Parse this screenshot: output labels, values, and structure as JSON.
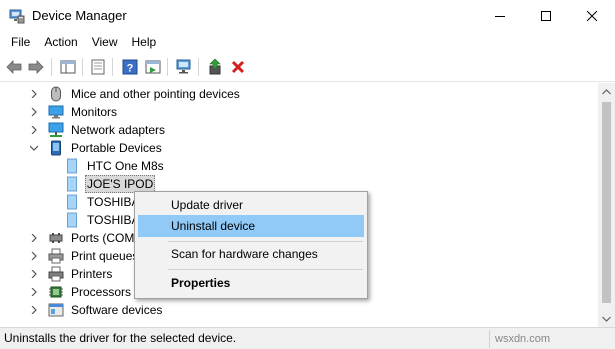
{
  "window": {
    "title": "Device Manager"
  },
  "menu": [
    "File",
    "Action",
    "View",
    "Help"
  ],
  "toolbar": {
    "buttons": [
      "back-icon",
      "forward-icon",
      "show-hide-console-tree-icon",
      "properties-icon",
      "help-icon",
      "action-pane-icon",
      "scan-hardware-icon",
      "update-driver-icon",
      "uninstall-device-icon"
    ]
  },
  "tree": {
    "rows": [
      {
        "label": "Mice and other pointing devices",
        "icon": "mouse-icon",
        "expanded": false
      },
      {
        "label": "Monitors",
        "icon": "monitor-icon",
        "expanded": false
      },
      {
        "label": "Network adapters",
        "icon": "network-adapter-icon",
        "expanded": false
      },
      {
        "label": "Portable Devices",
        "icon": "portable-device-icon",
        "expanded": true
      },
      {
        "label": "HTC One M8s",
        "icon": "portable-device-icon"
      },
      {
        "label": "JOE'S IPOD",
        "icon": "portable-device-icon",
        "selected": true
      },
      {
        "label": "TOSHIBA",
        "icon": "portable-device-icon"
      },
      {
        "label": "TOSHIBA",
        "icon": "portable-device-icon"
      },
      {
        "label": "Ports (COM &",
        "icon": "port-icon",
        "expanded": false
      },
      {
        "label": "Print queues",
        "icon": "print-queue-icon",
        "expanded": false
      },
      {
        "label": "Printers",
        "icon": "printer-icon",
        "expanded": false
      },
      {
        "label": "Processors",
        "icon": "processor-icon",
        "expanded": false
      },
      {
        "label": "Software devices",
        "icon": "software-device-icon",
        "expanded": false
      }
    ]
  },
  "context_menu": {
    "update_driver": "Update driver",
    "uninstall_device": "Uninstall device",
    "scan_hardware": "Scan for hardware changes",
    "properties": "Properties"
  },
  "status": {
    "text": "Uninstalls the driver for the selected device."
  },
  "watermark": "wsxdn.com",
  "colors": {
    "menu_highlight": "#91c9f7",
    "uninstall_red": "#d21f1f",
    "accent_blue": "#2f7fd1"
  }
}
